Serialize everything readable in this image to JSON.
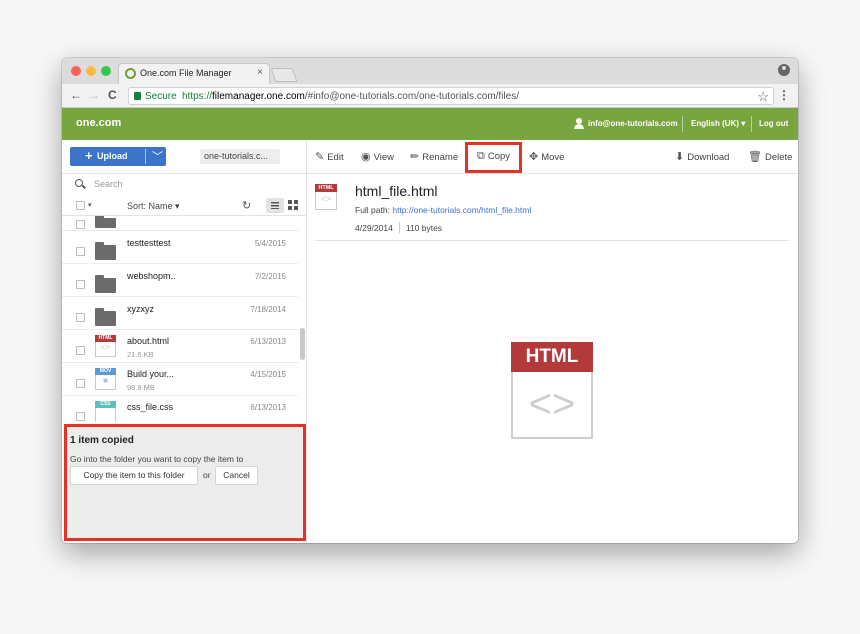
{
  "browser": {
    "tab_title": "One.com File Manager",
    "tab_close": "×",
    "secure_label": "Secure",
    "url_scheme": "https://",
    "url_host": "filemanager.one.com",
    "url_path": "/#info@one-tutorials.com/one-tutorials.com/files/",
    "back": "←",
    "forward": "→",
    "reload": "C",
    "star": "☆",
    "menu": "⋮"
  },
  "header": {
    "logo": "one.com",
    "email": "info@one-tutorials.com",
    "language": "English (UK) ▾",
    "logout": "Log out",
    "bg_color": "#79a541"
  },
  "toolbar": {
    "upload_label": "Upload",
    "upload_plus": "+",
    "upload_caret": "﹀",
    "current_folder": "one-tutorials.c...",
    "edit": "Edit",
    "view": "View",
    "rename": "Rename",
    "copy": "Copy",
    "move": "Move",
    "download": "Download",
    "delete": "Delete"
  },
  "list": {
    "search_placeholder": "Search",
    "sort_label": "Sort: Name ▾",
    "select_caret": "▾",
    "refresh": "↻",
    "files": [
      {
        "name": "testtesttest",
        "size": "",
        "date": "5/4/2015",
        "kind": "folder"
      },
      {
        "name": "webshopm..",
        "size": "",
        "date": "7/2/2015",
        "kind": "folder"
      },
      {
        "name": "xyzxyz",
        "size": "",
        "date": "7/18/2014",
        "kind": "folder"
      },
      {
        "name": "about.html",
        "size": "21.6 KB",
        "date": "6/13/2013",
        "kind": "HTML"
      },
      {
        "name": "Build your...",
        "size": "98.9 MB",
        "date": "4/15/2015",
        "kind": "MOV"
      },
      {
        "name": "css_file.css",
        "size": "",
        "date": "6/13/2013",
        "kind": "CSS"
      }
    ]
  },
  "notice": {
    "title": "1 item copied",
    "message": "Go into the folder you want to copy the item to",
    "copy_here": "Copy the item to this folder",
    "or": "or",
    "cancel": "Cancel"
  },
  "preview": {
    "filename": "html_file.html",
    "full_path_label": "Full path:",
    "full_path": "http://one-tutorials.com/html_file.html",
    "date": "4/29/2014",
    "size": "110 bytes",
    "icon_tag": "HTML",
    "icon_glyph": "<>"
  },
  "colors": {
    "accent": "#3b74c9",
    "highlight": "#e53226",
    "html_tag": "#b33a3a",
    "mov_tag": "#5b9bd5",
    "css_tag": "#5bbfbf"
  }
}
